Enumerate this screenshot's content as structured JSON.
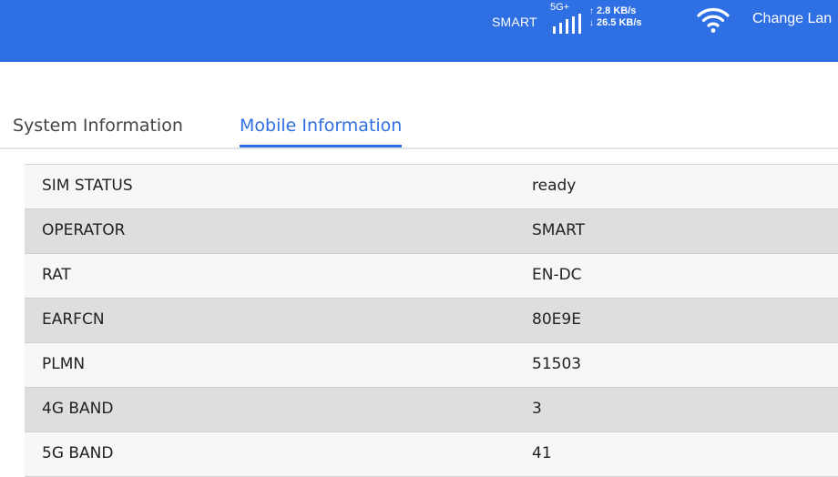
{
  "header": {
    "operator": "SMART",
    "network_type": "5G+",
    "signal_bars": 5,
    "upload_speed": "2.8 KB/s",
    "download_speed": "26.5 KB/s",
    "change_language_label": "Change Lan",
    "accent_color": "#2f6fe4"
  },
  "tabs": [
    {
      "label": "System Information",
      "active": false
    },
    {
      "label": "Mobile Information",
      "active": true
    }
  ],
  "mobile_info": [
    {
      "key": "SIM STATUS",
      "value": "ready"
    },
    {
      "key": "OPERATOR",
      "value": "SMART"
    },
    {
      "key": "RAT",
      "value": "EN-DC"
    },
    {
      "key": "EARFCN",
      "value": "80E9E"
    },
    {
      "key": "PLMN",
      "value": "51503"
    },
    {
      "key": "4G BAND",
      "value": "3"
    },
    {
      "key": "5G BAND",
      "value": "41"
    }
  ]
}
